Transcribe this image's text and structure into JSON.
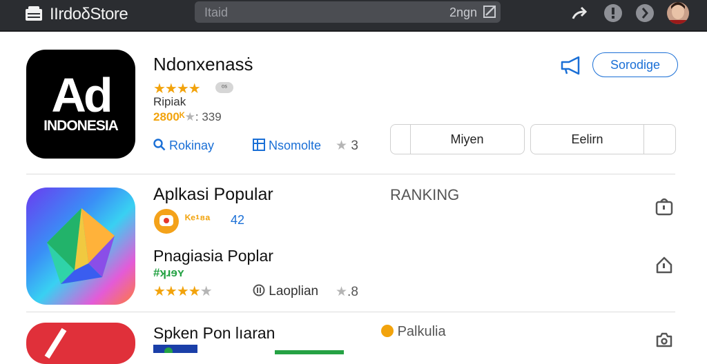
{
  "topbar": {
    "app_title": "IIrdoδStore",
    "search_placeholder": "Itaid",
    "search_right": "2ngn"
  },
  "featured": {
    "icon_big": "Ad",
    "icon_small": "INDONESIA",
    "name": "Ndonxenasṡ",
    "badge": "ᵒˢ",
    "subtitle": "Ripiak",
    "rating_line": "2800ᴷ",
    "rating_rest": ": 339",
    "link_ranking": "Rokinay",
    "link_promote": "Nsomolte",
    "count": "3",
    "primary_button": "Sorodige",
    "btn_left": "Miyen",
    "btn_right": "Eelirn"
  },
  "section1": {
    "name": "Aplkasi Popular",
    "ranking_label": "RANKING",
    "rating_text": "ᴷᵉ¹⁸ᵃ",
    "rating_value": "42"
  },
  "section2": {
    "name": "Pnagiasia Poplar",
    "code": "#ʞɹɘʏ",
    "label": "Laoplian",
    "value": ".8"
  },
  "section3": {
    "name": "Spken Pon lıaran",
    "tag": "Palkulia"
  },
  "colors": {
    "accent": "#1a6fd6",
    "star": "#f2a30c",
    "green": "#25a244"
  }
}
